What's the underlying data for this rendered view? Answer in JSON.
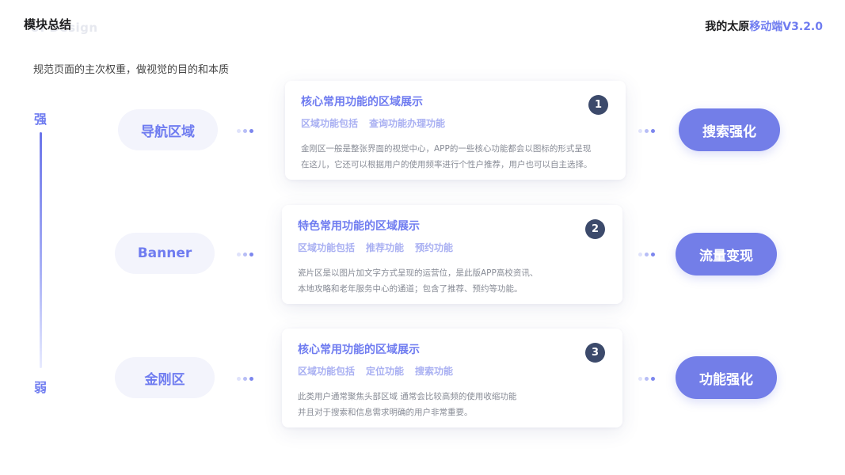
{
  "header": {
    "title": "模块总结",
    "watermark": "UI Design",
    "brand_prefix": "我的太原",
    "brand_accent": "移动端V3.2.0"
  },
  "subtitle": "规范页面的主次权重，做视觉的目的和本质",
  "scale": {
    "top_label": "强",
    "bottom_label": "弱"
  },
  "colors": {
    "accent": "#6f7cf0",
    "badge": "#3c4a6b",
    "pill_bg": "#f3f4fc"
  },
  "rows": [
    {
      "region": "导航区域",
      "card": {
        "number": "1",
        "title": "核心常用功能的区域展示",
        "tags": [
          "区域功能包括",
          "查询功能办理功能"
        ],
        "desc": [
          "金刚区一般是整张界面的视觉中心，APP的一些核心功能都会以图标的形式呈现",
          "在这儿，它还可以根据用户的使用频率进行个性户推荐，用户也可以自主选择。"
        ]
      },
      "value": "搜索强化"
    },
    {
      "region": "Banner",
      "card": {
        "number": "2",
        "title": "特色常用功能的区域展示",
        "tags": [
          "区域功能包括",
          "推荐功能",
          "预约功能"
        ],
        "desc": [
          "瓷片区是以图片加文字方式呈现的运营位，是此版APP高校资讯、",
          "本地攻略和老年服务中心的通道；包含了推荐、预约等功能。"
        ]
      },
      "value": "流量变现"
    },
    {
      "region": "金刚区",
      "card": {
        "number": "3",
        "title": "核心常用功能的区域展示",
        "tags": [
          "区域功能包括",
          "定位功能",
          "搜索功能"
        ],
        "desc": [
          "此类用户通常聚焦头部区域  通常会比较高频的使用收缩功能",
          "并且对于搜索和信息需求明确的用户非常重要。"
        ]
      },
      "value": "功能强化"
    }
  ]
}
